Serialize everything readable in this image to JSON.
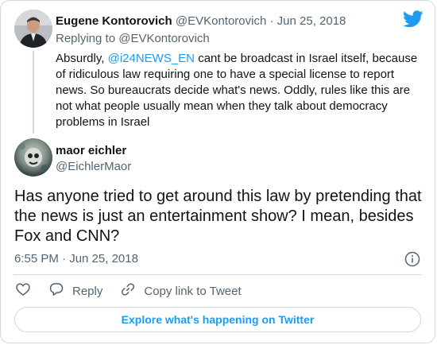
{
  "parent_tweet": {
    "author_name": "Eugene Kontorovich",
    "author_handle": "@EVKontorovich",
    "separator": "·",
    "date": "Jun 25, 2018",
    "replying_to_prefix": "Replying to",
    "replying_to_handle": "@EVKontorovich",
    "text_before_mention": "Absurdly, ",
    "mention": "@i24NEWS_EN",
    "text_after_mention": " cant be broadcast in Israel itself, because of ridiculous law requiring one to have a special license to report news. So bureaucrats decide what's news. Oddly, rules like this are not what people usually mean when they talk about democracy problems in Israel"
  },
  "tweet": {
    "author_name": "maor eichler",
    "author_handle": "@EichlerMaor",
    "text": "Has anyone tried to get around this law by pretending that the news is just an entertainment show? I mean, besides Fox and CNN?",
    "timestamp": "6:55 PM · Jun 25, 2018"
  },
  "actions": {
    "like_icon": "heart-icon",
    "reply_label": "Reply",
    "reply_icon": "speech-bubble-icon",
    "copy_link_label": "Copy link to Tweet",
    "copy_link_icon": "link-icon"
  },
  "explore_button_label": "Explore what's happening on Twitter",
  "colors": {
    "accent": "#1d9bf0",
    "text": "#0f1419",
    "muted": "#536471",
    "border": "#cfd9de"
  }
}
